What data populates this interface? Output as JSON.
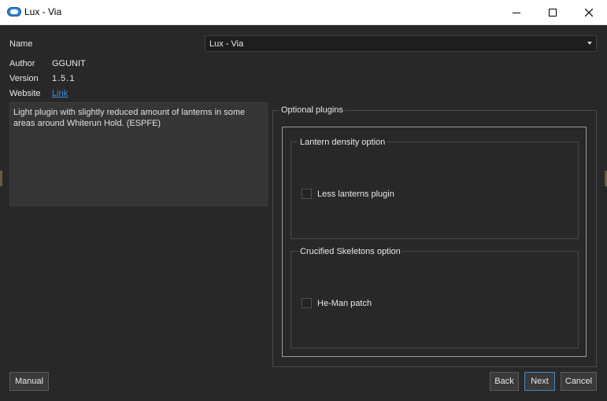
{
  "window": {
    "title": "Lux - Via"
  },
  "header": {
    "name_label": "Name",
    "name_value": "Lux - Via",
    "author_label": "Author",
    "author_value": "GGUNIT",
    "version_label": "Version",
    "version_value": "1.5.1",
    "website_label": "Website",
    "website_link": "Link"
  },
  "description": "Light plugin with slightly reduced amount of lanterns in some areas around Whiterun Hold. (ESPFE)",
  "plugins": {
    "title": "Optional plugins",
    "groups": [
      {
        "title": "Lantern density option",
        "option": "Less lanterns plugin",
        "checked": false
      },
      {
        "title": "Crucified Skeletons option",
        "option": "He-Man patch",
        "checked": false
      }
    ]
  },
  "buttons": {
    "manual": "Manual",
    "back": "Back",
    "next": "Next",
    "cancel": "Cancel"
  },
  "colors": {
    "background": "#282828",
    "link": "#3d8ee6",
    "default_button_border": "#4a86c6"
  }
}
